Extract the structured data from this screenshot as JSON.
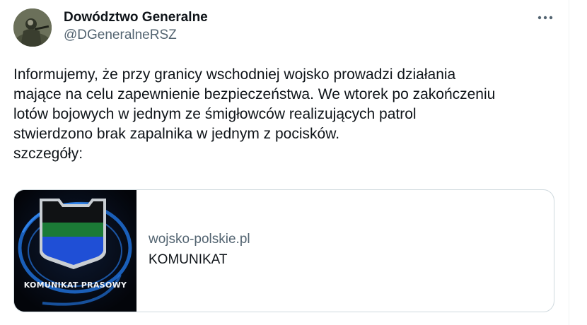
{
  "tweet": {
    "author": {
      "display_name": "Dowództwo Generalne",
      "handle": "@DGeneralneRSZ",
      "avatar_icon": "soldier-avatar-icon"
    },
    "more_icon": "more-options-icon",
    "text_lines": [
      "Informujemy, że przy granicy wschodniej wojsko prowadzi działania",
      "mające na celu zapewnienie bezpieczeństwa. We wtorek po zakończeniu",
      "lotów bojowych w jednym ze śmigłowców realizujących patrol",
      "stwierdzono brak zapalnika w jednym z pocisków.",
      "szczegóły:"
    ],
    "link_card": {
      "thumbnail_caption": "KOMUNIKAT PRASOWY",
      "domain": "wojsko-polskie.pl",
      "title": "KOMUNIKAT"
    }
  },
  "colors": {
    "text_primary": "#0f1419",
    "text_secondary": "#536471",
    "border": "#cfd9de",
    "thumb_background": "#05070d",
    "thumb_ring_blue": "#1f6fd6",
    "badge_green": "#1b7a36",
    "badge_blue": "#1f4fd6",
    "badge_black": "#101214"
  }
}
